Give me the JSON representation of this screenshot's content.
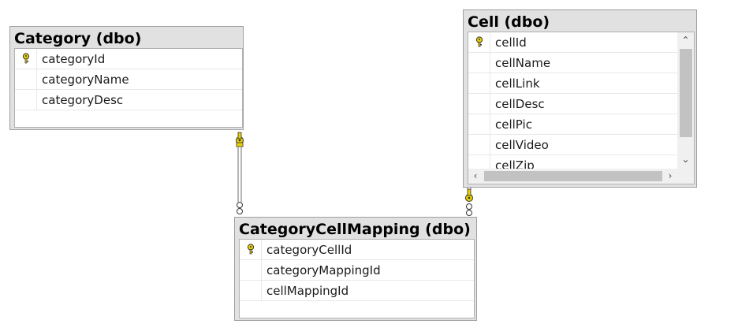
{
  "tables": {
    "category": {
      "title": "Category (dbo)",
      "columns": [
        {
          "name": "categoryId",
          "primary_key": true
        },
        {
          "name": "categoryName",
          "primary_key": false
        },
        {
          "name": "categoryDesc",
          "primary_key": false
        }
      ]
    },
    "cell": {
      "title": "Cell (dbo)",
      "columns": [
        {
          "name": "cellId",
          "primary_key": true
        },
        {
          "name": "cellName",
          "primary_key": false
        },
        {
          "name": "cellLink",
          "primary_key": false
        },
        {
          "name": "cellDesc",
          "primary_key": false
        },
        {
          "name": "cellPic",
          "primary_key": false
        },
        {
          "name": "cellVideo",
          "primary_key": false
        },
        {
          "name": "cellZip",
          "primary_key": false
        }
      ]
    },
    "mapping": {
      "title": "CategoryCellMapping (dbo)",
      "columns": [
        {
          "name": "categoryCellId",
          "primary_key": true
        },
        {
          "name": "categoryMappingId",
          "primary_key": false
        },
        {
          "name": "cellMappingId",
          "primary_key": false
        }
      ]
    }
  },
  "relationships": [
    {
      "from": "Category",
      "to": "CategoryCellMapping"
    },
    {
      "from": "Cell",
      "to": "CategoryCellMapping"
    }
  ],
  "colors": {
    "key_yellow": "#e8d000",
    "header_bg": "#e1e1e1",
    "border": "#a0a0a0"
  },
  "icons": {
    "primary_key": "key-icon",
    "scroll_up": "chevron-up-icon",
    "scroll_down": "chevron-down-icon",
    "scroll_left": "chevron-left-icon",
    "scroll_right": "chevron-right-icon"
  }
}
